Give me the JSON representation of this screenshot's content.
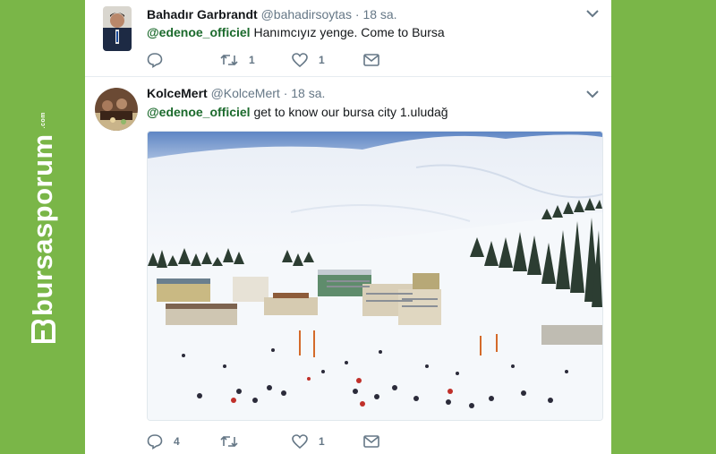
{
  "brand": {
    "logo_text": "bursasporum",
    "logo_sup": ".com"
  },
  "tweets": [
    {
      "fullname": "Bahadır Garbrandt",
      "handle": "@bahadirsoytas",
      "time": "18 sa.",
      "mention": "@edenoe_officiel",
      "text": " Hanımcıyız yenge. Come to Bursa",
      "reply_count": "",
      "retweet_count": "1",
      "like_count": "1"
    },
    {
      "fullname": "KolceMert",
      "handle": "@KolceMert",
      "time": "18 sa.",
      "mention": "@edenoe_officiel",
      "text": " get to know our bursa city 1.uludağ",
      "reply_count": "4",
      "retweet_count": "",
      "like_count": "1"
    }
  ],
  "separator": "·",
  "colors": {
    "page_bg": "#7ab648",
    "mention": "#1b6a2c",
    "meta": "#657786"
  },
  "icons": [
    "chevron-down-icon",
    "reply-icon",
    "retweet-icon",
    "like-icon",
    "message-icon"
  ]
}
